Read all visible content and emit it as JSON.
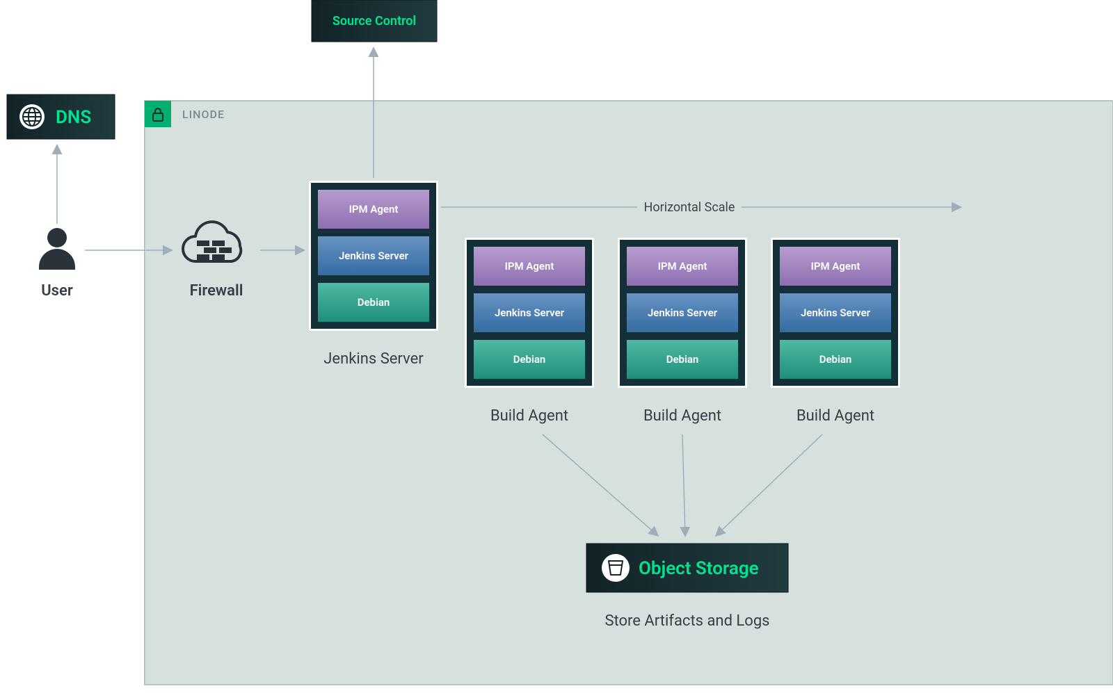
{
  "colors": {
    "badge_bg_from": "#122327",
    "badge_bg_to": "#203c3e",
    "accent_green": "#00e393",
    "region_bg": "#d6e0dd",
    "region_border": "#b8c6c1",
    "stack_border": "#133038",
    "stack_halo": "#ffffff",
    "arrow_gray": "#a0adb8",
    "layer1_from": "#a57cb2",
    "layer1_to": "#b89bcf",
    "layer2_from": "#356ca3",
    "layer2_to": "#6893c3",
    "layer3_from": "#1f8f7c",
    "layer3_to": "#4fb9a1"
  },
  "dns": {
    "label": "DNS"
  },
  "user": {
    "label": "User"
  },
  "firewall": {
    "label": "Firewall"
  },
  "source_control": {
    "label": "Source Control"
  },
  "region": {
    "label": "LINODE"
  },
  "hscale": {
    "label": "Horizontal Scale"
  },
  "object_storage": {
    "label": "Object Storage",
    "caption": "Store Artifacts and Logs"
  },
  "jenkins_server": {
    "caption": "Jenkins Server",
    "layers": [
      "IPM Agent",
      "Jenkins Server",
      "Debian"
    ]
  },
  "build_agents": [
    {
      "caption": "Build Agent",
      "layers": [
        "IPM Agent",
        "Jenkins Server",
        "Debian"
      ]
    },
    {
      "caption": "Build Agent",
      "layers": [
        "IPM Agent",
        "Jenkins Server",
        "Debian"
      ]
    },
    {
      "caption": "Build Agent",
      "layers": [
        "IPM Agent",
        "Jenkins Server",
        "Debian"
      ]
    }
  ]
}
